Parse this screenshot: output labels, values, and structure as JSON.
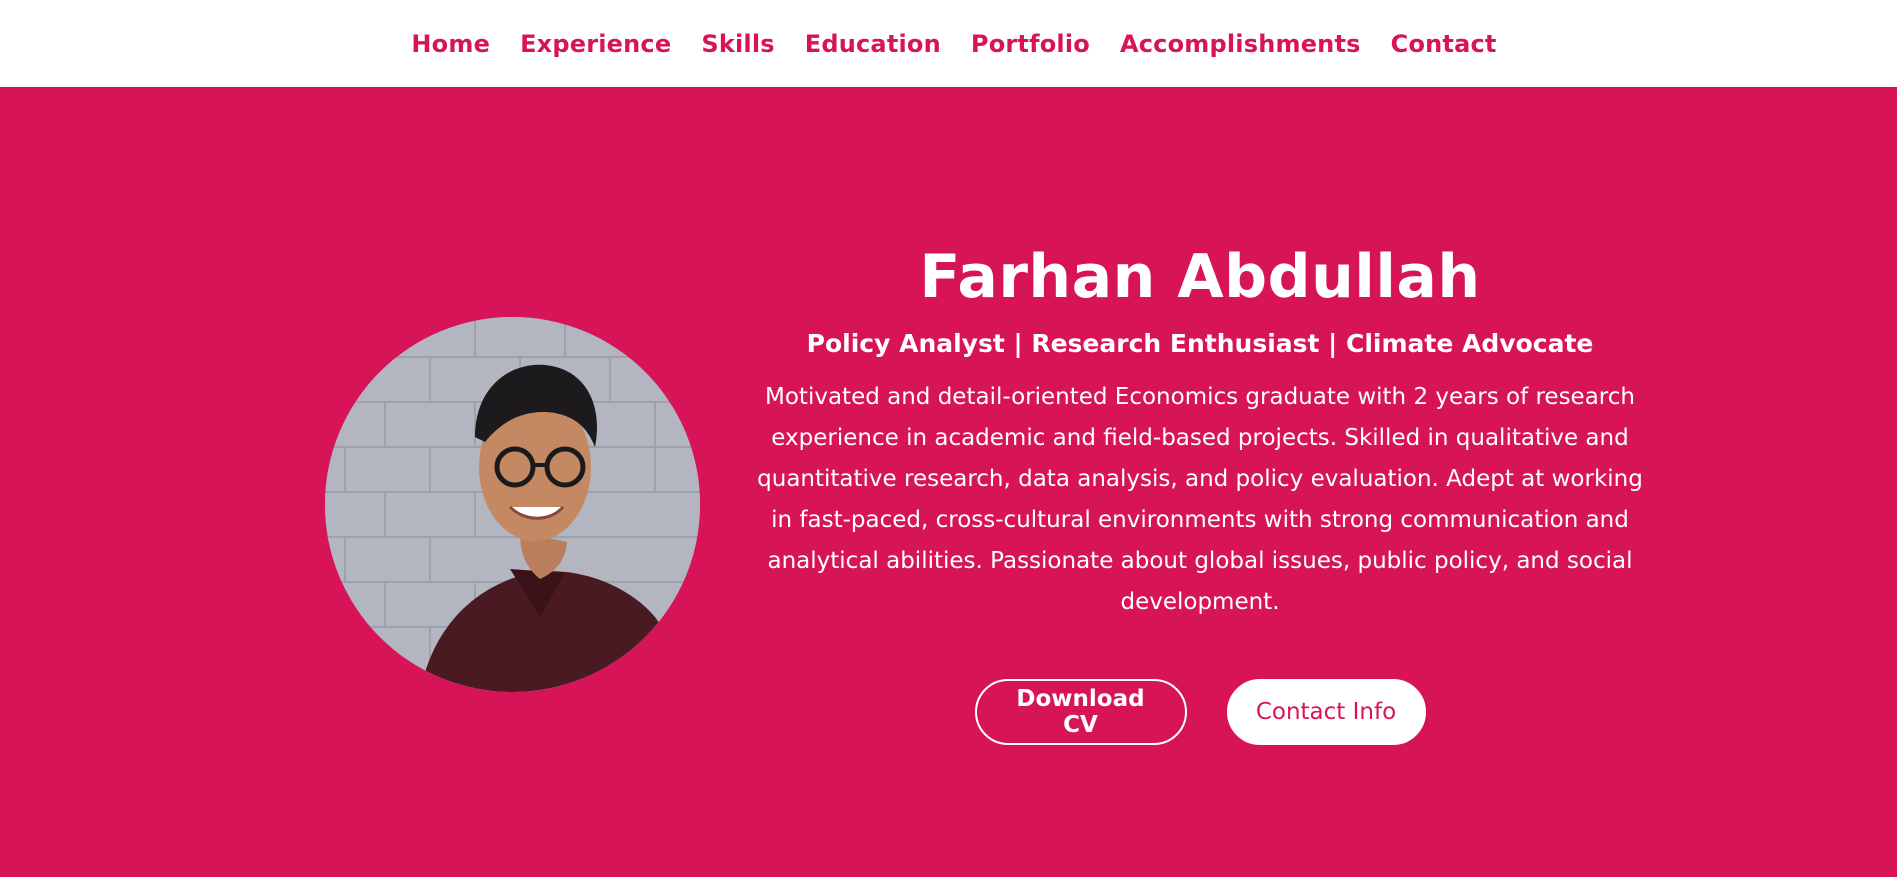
{
  "colors": {
    "accent": "#d81459",
    "surface": "#ffffff"
  },
  "nav": {
    "items": [
      {
        "label": "Home"
      },
      {
        "label": "Experience"
      },
      {
        "label": "Skills"
      },
      {
        "label": "Education"
      },
      {
        "label": "Portfolio"
      },
      {
        "label": "Accomplishments"
      },
      {
        "label": "Contact"
      }
    ]
  },
  "hero": {
    "name": "Farhan Abdullah",
    "tagline": "Policy Analyst | Research Enthusiast | Climate Advocate",
    "bio": "Motivated and detail-oriented Economics graduate with 2 years of research experience in academic and field-based projects. Skilled in qualitative and quantitative research, data analysis, and policy evaluation. Adept at working in fast-paced, cross-cultural environments with strong communication and analytical abilities. Passionate about global issues, public policy, and social development.",
    "download_cv": "Download CV",
    "contact_info": "Contact Info"
  }
}
